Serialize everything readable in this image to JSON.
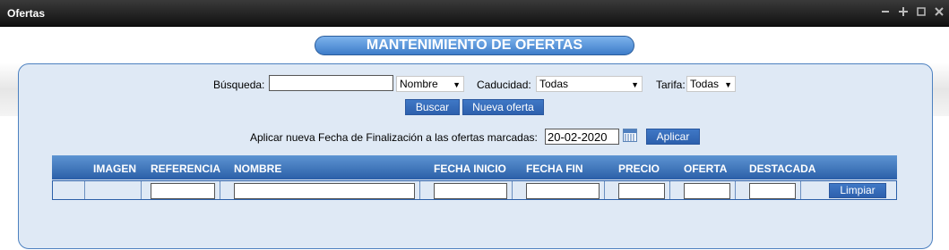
{
  "window": {
    "title": "Ofertas",
    "controls": [
      "minimize-icon",
      "move-icon",
      "maximize-icon",
      "close-icon"
    ]
  },
  "heading": "MANTENIMIENTO DE OFERTAS",
  "search": {
    "busqueda_label": "Búsqueda:",
    "busqueda_value": "",
    "field_select": "Nombre",
    "caducidad_label": "Caducidad:",
    "caducidad_value": "Todas",
    "tarifa_label": "Tarifa:",
    "tarifa_value": "Todas",
    "buscar_label": "Buscar",
    "nueva_label": "Nueva oferta"
  },
  "apply": {
    "label": "Aplicar nueva Fecha de Finalización a las ofertas marcadas:",
    "date_value": "20-02-2020",
    "button_label": "Aplicar"
  },
  "table": {
    "columns": [
      "IMAGEN",
      "REFERENCIA",
      "NOMBRE",
      "FECHA INICIO",
      "FECHA FIN",
      "PRECIO",
      "OFERTA",
      "DESTACADA"
    ],
    "clear_label": "Limpiar"
  },
  "colors": {
    "accent": "#3d7cc9",
    "panel_bg": "#dfe9f5",
    "titlebar": "#1c1c1c"
  }
}
